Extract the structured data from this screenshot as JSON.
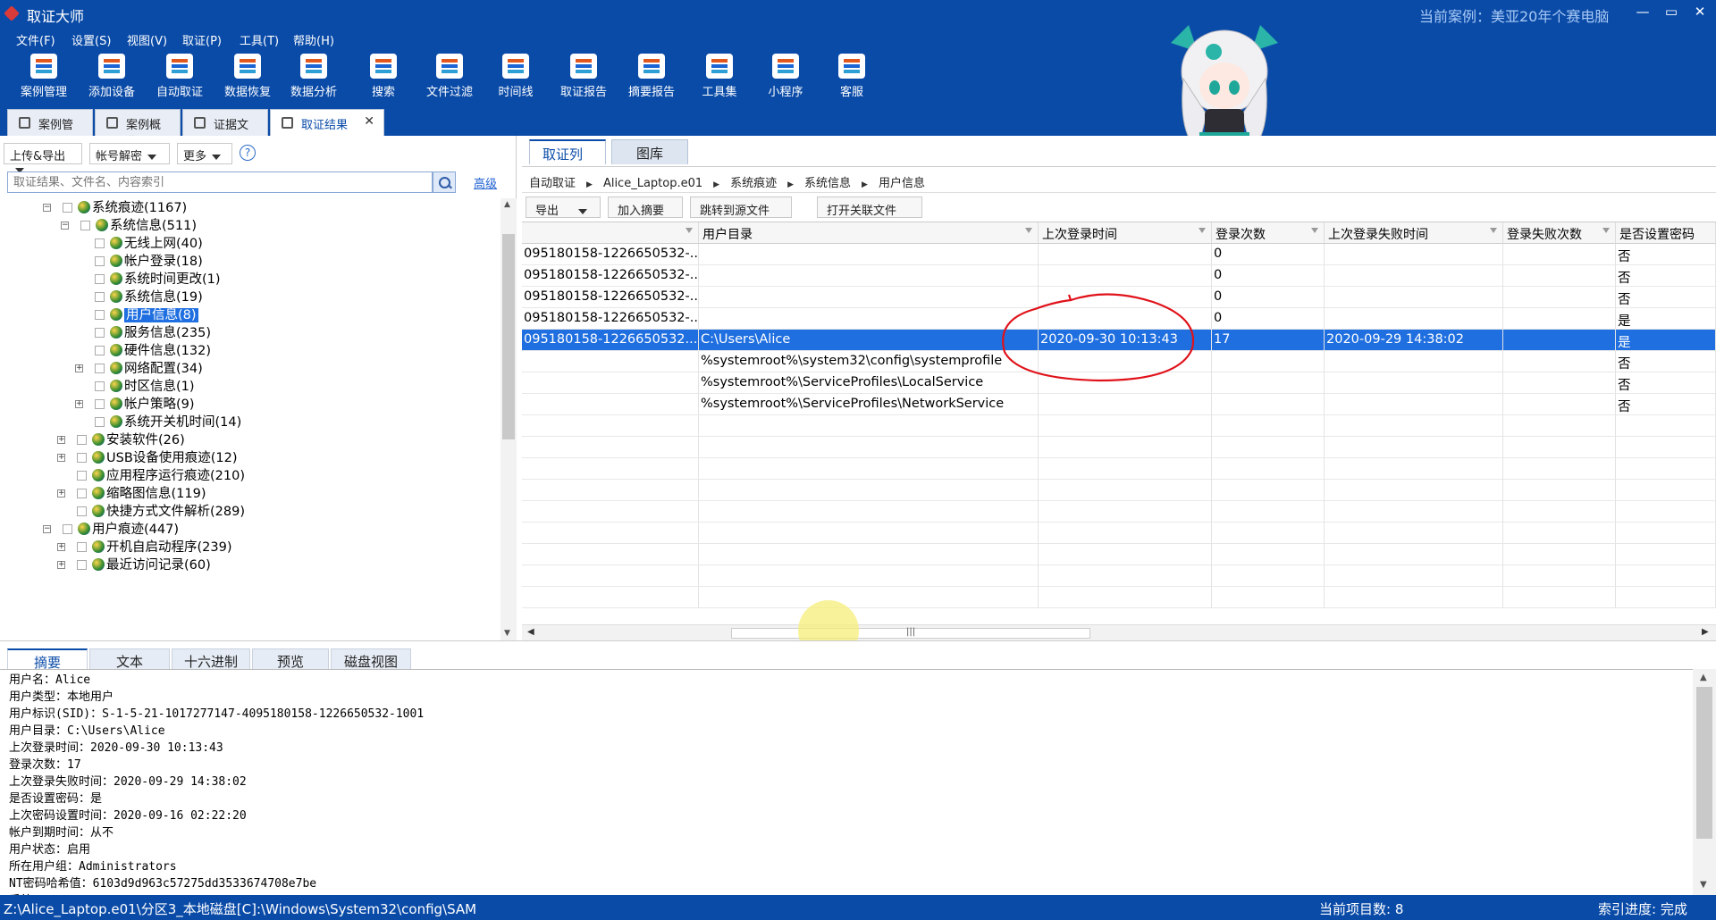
{
  "window": {
    "title": "取证大师",
    "case_label": "当前案例：美亚20年个赛电脑",
    "controls": [
      "—",
      "▭",
      "✕"
    ]
  },
  "menu": [
    "文件(F)",
    "设置(S)",
    "视图(V)",
    "取证(P)",
    "工具(T)",
    "帮助(H)"
  ],
  "toolbar": [
    "案例管理",
    "添加设备",
    "自动取证",
    "数据恢复",
    "数据分析",
    "搜索",
    "文件过滤",
    "时间线",
    "取证报告",
    "摘要报告",
    "工具集",
    "小程序",
    "客服"
  ],
  "tabs": [
    {
      "label": "案例管理"
    },
    {
      "label": "案例概览"
    },
    {
      "label": "证据文件"
    },
    {
      "label": "取证结果",
      "close": "✕"
    }
  ],
  "left": {
    "buttons": [
      "上传&导出",
      "帐号解密",
      "更多"
    ],
    "help": "?",
    "search_placeholder": "取证结果、文件名、内容索引",
    "advanced": "高级",
    "tree": [
      {
        "label": "系统痕迹(1167)",
        "exp": "−"
      },
      {
        "label": "系统信息(511)",
        "exp": "−"
      },
      {
        "label": "无线上网(40)"
      },
      {
        "label": "帐户登录(18)"
      },
      {
        "label": "系统时间更改(1)"
      },
      {
        "label": "系统信息(19)"
      },
      {
        "label": "用户信息(8)"
      },
      {
        "label": "服务信息(235)"
      },
      {
        "label": "硬件信息(132)"
      },
      {
        "label": "网络配置(34)",
        "exp": "+"
      },
      {
        "label": "时区信息(1)"
      },
      {
        "label": "帐户策略(9)",
        "exp": "+"
      },
      {
        "label": "系统开关机时间(14)"
      },
      {
        "label": "安装软件(26)",
        "exp": "+"
      },
      {
        "label": "USB设备使用痕迹(12)",
        "exp": "+"
      },
      {
        "label": "应用程序运行痕迹(210)"
      },
      {
        "label": "缩略图信息(119)",
        "exp": "+"
      },
      {
        "label": "快捷方式文件解析(289)"
      },
      {
        "label": "用户痕迹(447)",
        "exp": "−"
      },
      {
        "label": "开机自启动程序(239)",
        "exp": "+"
      },
      {
        "label": "最近访问记录(60)",
        "exp": "+"
      }
    ]
  },
  "right": {
    "tabs": [
      "取证列表",
      "图库"
    ],
    "breadcrumb": [
      "自动取证",
      "Alice_Laptop.e01",
      "系统痕迹",
      "系统信息",
      "用户信息"
    ],
    "actions": [
      "导出",
      "加入摘要",
      "跳转到源文件",
      "打开关联文件"
    ],
    "columns": [
      "",
      "用户目录",
      "上次登录时间",
      "登录次数",
      "上次登录失败时间",
      "登录失败次数",
      "是否设置密码"
    ],
    "rows": [
      [
        "095180158-1226650532-...",
        "",
        "",
        "0",
        "",
        "",
        "否"
      ],
      [
        "095180158-1226650532-...",
        "",
        "",
        "0",
        "",
        "",
        "否"
      ],
      [
        "095180158-1226650532-...",
        "",
        "",
        "0",
        "",
        "",
        "否"
      ],
      [
        "095180158-1226650532-...",
        "",
        "",
        "0",
        "",
        "",
        "是"
      ],
      [
        "095180158-1226650532...",
        "C:\\Users\\Alice",
        "2020-09-30 10:13:43",
        "17",
        "2020-09-29 14:38:02",
        "",
        "是"
      ],
      [
        "",
        "%systemroot%\\system32\\config\\systemprofile",
        "",
        "",
        "",
        "",
        "否"
      ],
      [
        "",
        "%systemroot%\\ServiceProfiles\\LocalService",
        "",
        "",
        "",
        "",
        "否"
      ],
      [
        "",
        "%systemroot%\\ServiceProfiles\\NetworkService",
        "",
        "",
        "",
        "",
        "否"
      ]
    ],
    "selected_row": 4
  },
  "bottom": {
    "tabs": [
      "摘要",
      "文本",
      "十六进制",
      "预览",
      "磁盘视图"
    ],
    "detail_lines": [
      "用户名：Alice",
      "用户类型：本地用户",
      "用户标识(SID)：S-1-5-21-1017277147-4095180158-1226650532-1001",
      "用户目录：C:\\Users\\Alice",
      "上次登录时间：2020-09-30 10:13:43",
      "登录次数：17",
      "上次登录失败时间：2020-09-29 14:38:02",
      "是否设置密码：是",
      "上次密码设置时间：2020-09-16 02:22:20",
      "帐户到期时间：从不",
      "用户状态：启用",
      "所在用户组：Administrators",
      "NT密码哈希值：6103d9d963c57275dd3533674708e7be",
      "系统..."
    ]
  },
  "status": {
    "path": "Z:\\Alice_Laptop.e01\\分区3_本地磁盘[C]:\\Windows\\System32\\config\\SAM",
    "item_count": "当前项目数: 8",
    "index_progress": "索引进度: 完成"
  },
  "colors": {
    "primary": "#0a4ba8",
    "selection": "#1f6fe0",
    "annotation": "#e0121a"
  }
}
